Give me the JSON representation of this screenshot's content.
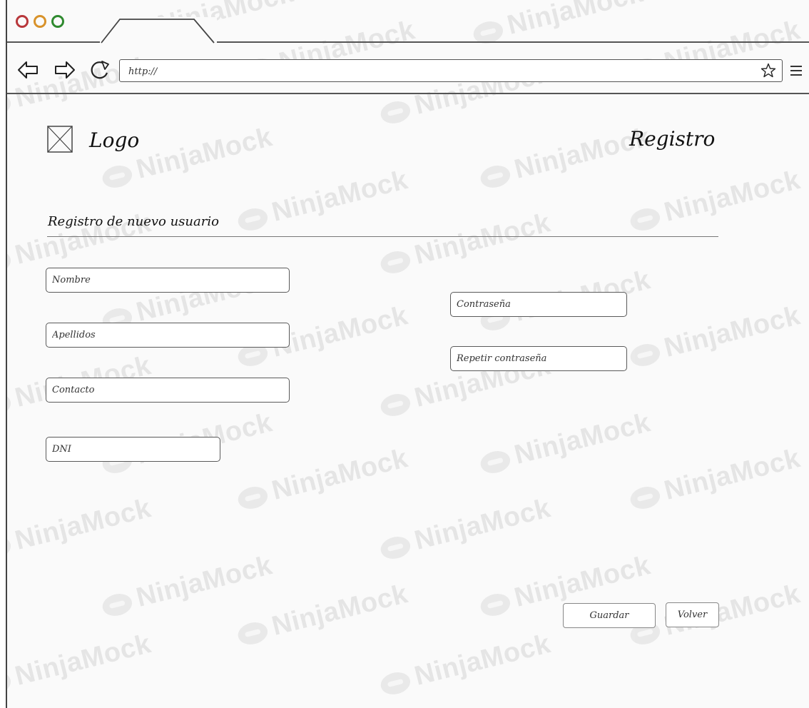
{
  "browser": {
    "url": "http://",
    "watermark": "NinjaMock"
  },
  "header": {
    "logo_label": "Logo",
    "page_title": "Registro"
  },
  "form": {
    "section_title": "Registro de nuevo usuario",
    "fields": {
      "nombre": "Nombre",
      "apellidos": "Apellidos",
      "contacto": "Contacto",
      "dni": "DNI",
      "contrasena": "Contraseña",
      "repetir_contrasena": "Repetir contraseña"
    },
    "buttons": {
      "guardar": "Guardar",
      "volver": "Volver"
    }
  }
}
